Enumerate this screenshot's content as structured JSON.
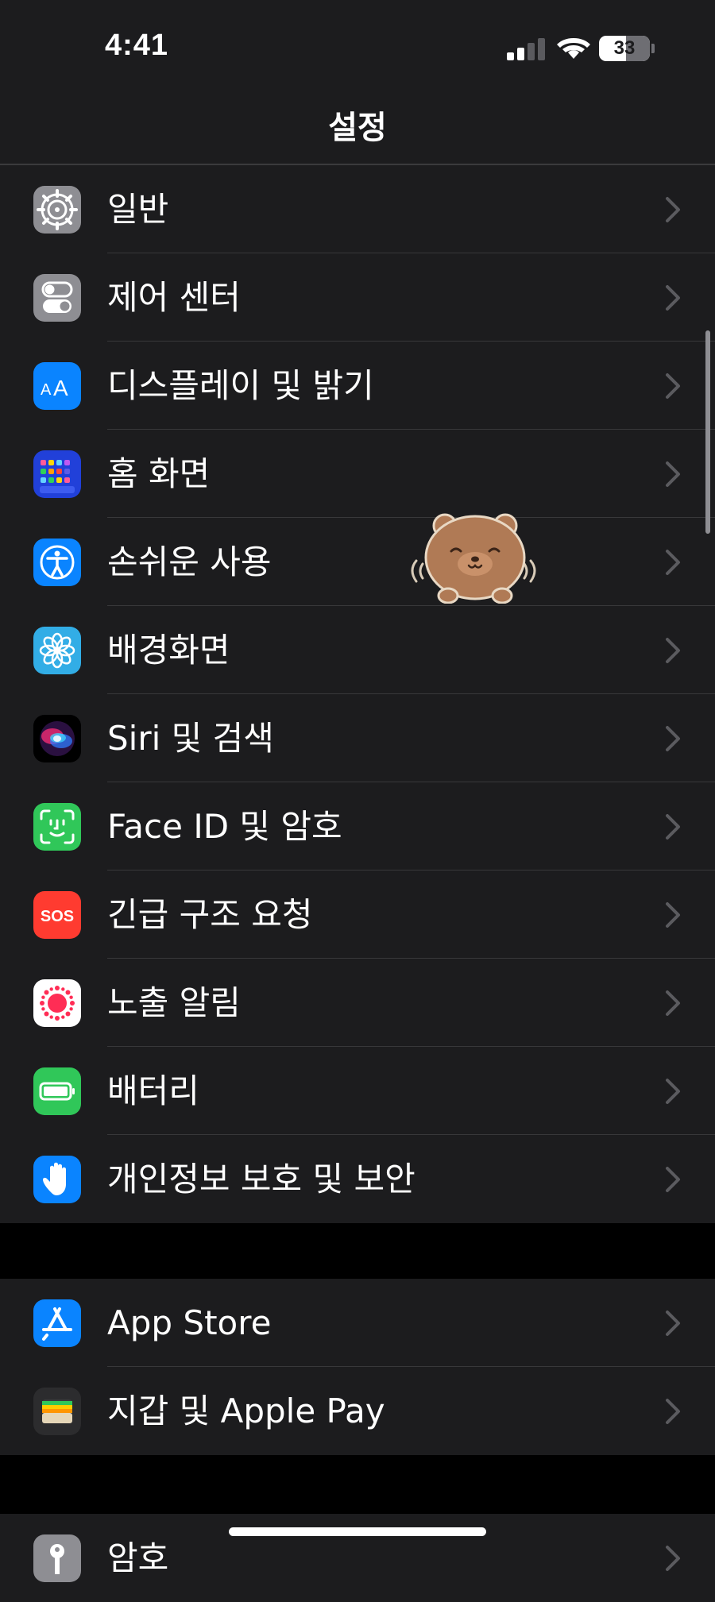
{
  "status_bar": {
    "time": "4:41",
    "battery_level": "33",
    "signal_bars_active": 2,
    "signal_bars_total": 4
  },
  "nav": {
    "title": "설정"
  },
  "groups": [
    {
      "rows": [
        {
          "label": "일반",
          "icon": "gear-icon",
          "color": "#8e8e93"
        },
        {
          "label": "제어 센터",
          "icon": "toggles-icon",
          "color": "#8e8e93"
        },
        {
          "label": "디스플레이 및 밝기",
          "icon": "text-size-icon",
          "color": "#0a84ff"
        },
        {
          "label": "홈 화면",
          "icon": "home-grid-icon",
          "color": "#2140d9"
        },
        {
          "label": "손쉬운 사용",
          "icon": "accessibility-icon",
          "color": "#0a84ff"
        },
        {
          "label": "배경화면",
          "icon": "flower-icon",
          "color": "#32ade6"
        },
        {
          "label": "Siri 및 검색",
          "icon": "siri-icon",
          "color": "#000000"
        },
        {
          "label": "Face ID 및 암호",
          "icon": "face-id-icon",
          "color": "#30c759"
        },
        {
          "label": "긴급 구조 요청",
          "icon": "sos-icon",
          "color": "#ff3b30",
          "icon_text": "SOS"
        },
        {
          "label": "노출 알림",
          "icon": "exposure-icon",
          "color": "#ffffff"
        },
        {
          "label": "배터리",
          "icon": "battery-icon",
          "color": "#30c759"
        },
        {
          "label": "개인정보 보호 및 보안",
          "icon": "hand-icon",
          "color": "#0a84ff"
        }
      ]
    },
    {
      "rows": [
        {
          "label": "App Store",
          "icon": "app-store-icon",
          "color": "#0a84ff"
        },
        {
          "label": "지갑 및 Apple Pay",
          "icon": "wallet-icon",
          "color": "#2c2c2e"
        }
      ]
    },
    {
      "rows": [
        {
          "label": "암호",
          "icon": "key-icon",
          "color": "#8e8e93"
        }
      ]
    }
  ]
}
